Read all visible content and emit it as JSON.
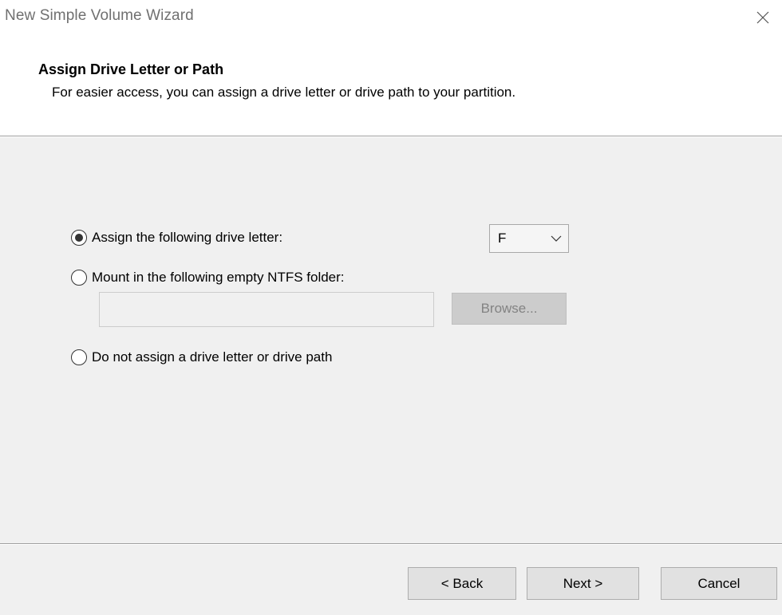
{
  "window": {
    "title": "New Simple Volume Wizard"
  },
  "header": {
    "title": "Assign Drive Letter or Path",
    "subtitle": "For easier access, you can assign a drive letter or drive path to your partition."
  },
  "options": {
    "assign_letter": {
      "label": "Assign the following drive letter:",
      "selected": true
    },
    "mount_folder": {
      "label": "Mount in the following empty NTFS folder:",
      "selected": false,
      "folder_value": "",
      "browse_label": "Browse..."
    },
    "no_assign": {
      "label": "Do not assign a drive letter or drive path",
      "selected": false
    }
  },
  "drive_letter": {
    "selected_value": "F"
  },
  "footer": {
    "back_label": "< Back",
    "next_label": "Next >",
    "cancel_label": "Cancel"
  },
  "icons": {
    "close": "close-icon",
    "dropdown": "chevron-down-icon"
  }
}
